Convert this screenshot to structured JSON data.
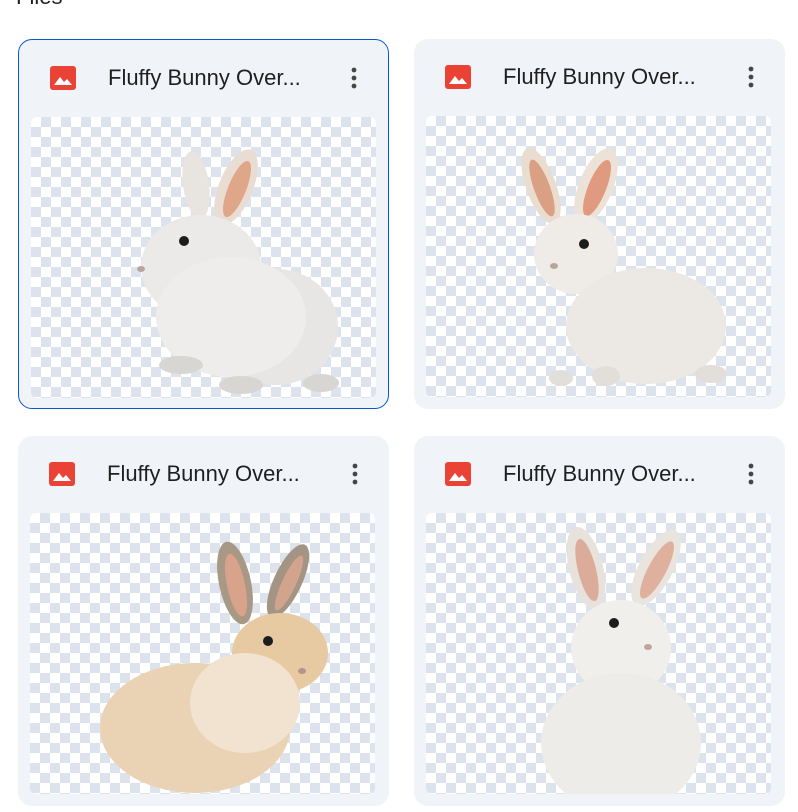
{
  "section": {
    "label": "Files"
  },
  "cards": [
    {
      "title": "Fluffy Bunny Over...",
      "file_icon": "image-file-icon",
      "menu_icon": "more-vert-icon",
      "selected": true
    },
    {
      "title": "Fluffy Bunny Over...",
      "file_icon": "image-file-icon",
      "menu_icon": "more-vert-icon",
      "selected": false
    },
    {
      "title": "Fluffy Bunny Over...",
      "file_icon": "image-file-icon",
      "menu_icon": "more-vert-icon",
      "selected": false
    },
    {
      "title": "Fluffy Bunny Over...",
      "file_icon": "image-file-icon",
      "menu_icon": "more-vert-icon",
      "selected": false
    }
  ],
  "colors": {
    "card_bg": "#f0f4f9",
    "selected_border": "#0b57d0",
    "image_icon": "#ea4335",
    "checker": "#dde3ec"
  }
}
